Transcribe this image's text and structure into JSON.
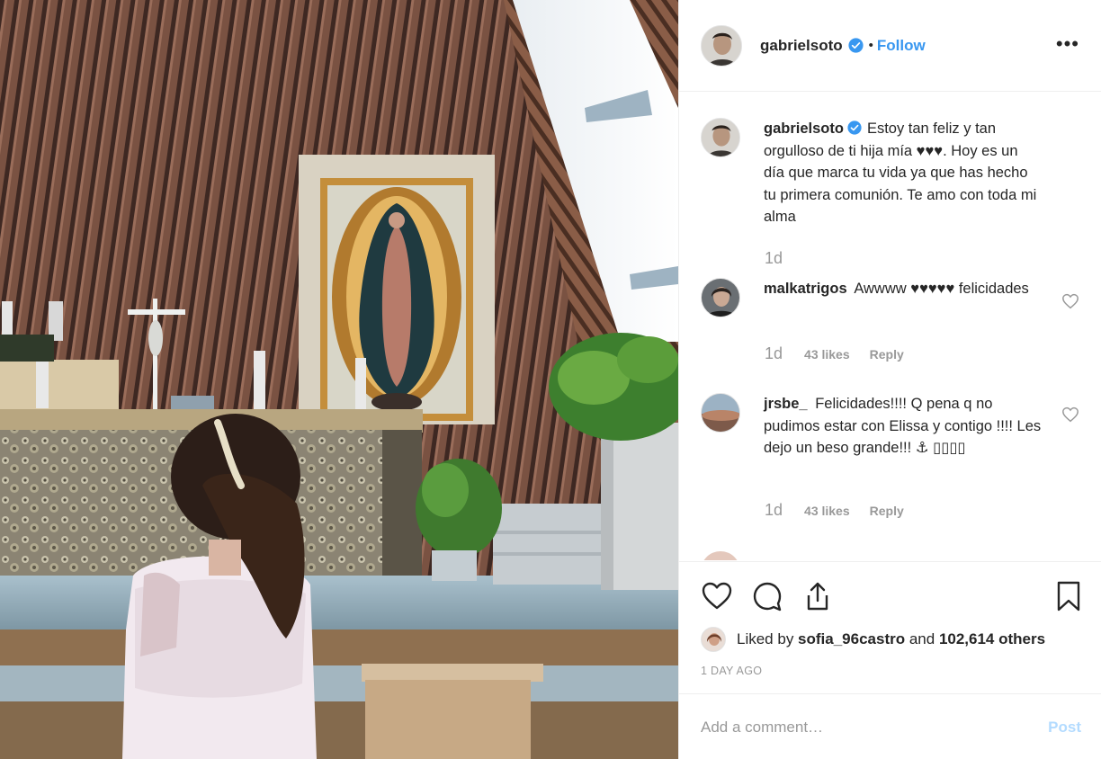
{
  "post": {
    "username": "gabrielsoto",
    "follow_label": "Follow",
    "dot": "•",
    "more_label": "•••"
  },
  "caption": {
    "username": "gabrielsoto",
    "text": "Estoy tan feliz y tan orgulloso de ti hija mía ♥♥♥. Hoy es un día que marca tu vida ya que has hecho tu primera comunión. Te amo con toda mi alma",
    "time": "1d"
  },
  "comments": [
    {
      "username": "malkatrigos",
      "text": "Awwww ♥♥♥♥♥ felicidades",
      "time": "1d",
      "likes": "43 likes",
      "reply": "Reply"
    },
    {
      "username": "jrsbe_",
      "text": "Felicidades!!!! Q pena q no pudimos estar con Elissa y contigo !!!! Les dejo un beso grande!!! ⚓ ▯▯▯▯",
      "time": "1d",
      "likes": "43 likes",
      "reply": "Reply"
    }
  ],
  "likes_line": {
    "prefix": "Liked by ",
    "user": "sofia_96castro",
    "middle": " and ",
    "count": "102,614 others"
  },
  "timestamp": "1 DAY AGO",
  "add_comment": {
    "placeholder": "Add a comment…",
    "post_label": "Post"
  },
  "icons": {
    "like": "heart-icon",
    "comment": "comment-bubble-icon",
    "share": "share-icon",
    "save": "bookmark-icon",
    "verified": "verified-badge-icon",
    "more": "more-options-icon"
  },
  "colors": {
    "link": "#3897f0",
    "post_disabled": "#b3dbff",
    "muted": "#999999",
    "text": "#262626"
  }
}
